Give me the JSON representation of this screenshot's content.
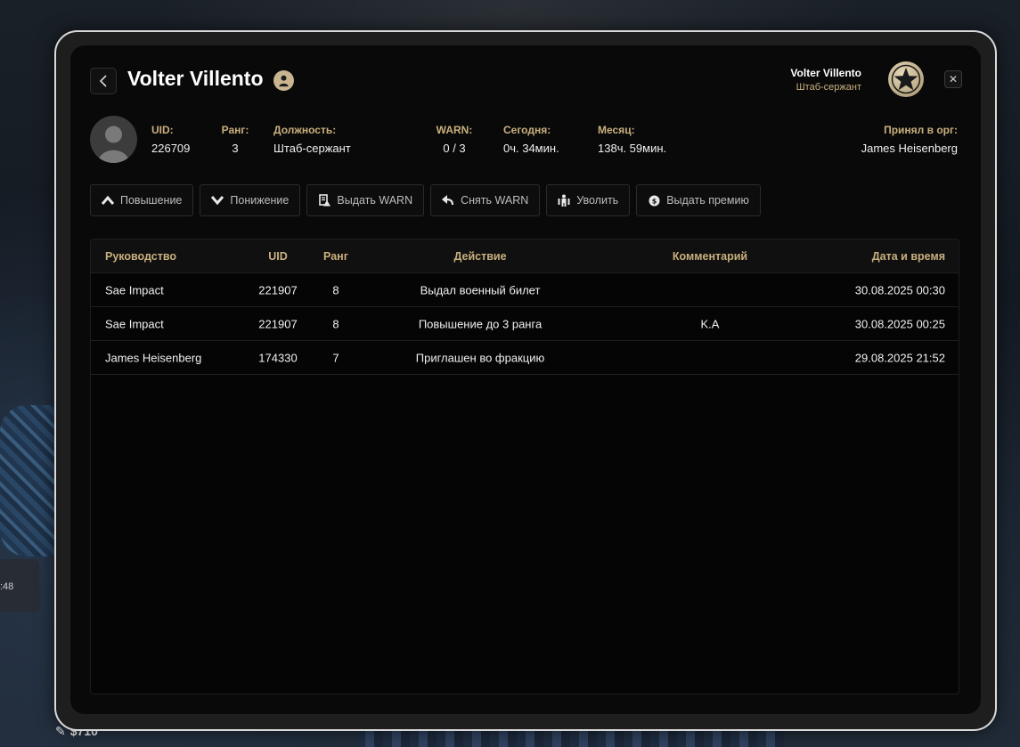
{
  "background": {
    "side_chip_text": ":48",
    "money": "$710"
  },
  "header": {
    "title": "Volter Villento",
    "user_name": "Volter Villento",
    "user_rank": "Штаб-сержант",
    "back_icon": "chevron-left-icon",
    "close_icon": "close-icon",
    "emblem_icon": "star-emblem-icon"
  },
  "info": {
    "uid_label": "UID:",
    "uid_value": "226709",
    "rank_label": "Ранг:",
    "rank_value": "3",
    "position_label": "Должность:",
    "position_value": "Штаб-сержант",
    "warn_label": "WARN:",
    "warn_value": "0 / 3",
    "today_label": "Сегодня:",
    "today_value": "0ч. 34мин.",
    "month_label": "Месяц:",
    "month_value": "138ч. 59мин.",
    "accepted_label": "Принял в орг:",
    "accepted_value": "James Heisenberg"
  },
  "actions": {
    "promote": "Повышение",
    "demote": "Понижение",
    "give_warn": "Выдать WARN",
    "remove_warn": "Снять WARN",
    "fire": "Уволить",
    "bonus": "Выдать премию"
  },
  "table": {
    "headers": {
      "leader": "Руководство",
      "uid": "UID",
      "rank": "Ранг",
      "action": "Действие",
      "comment": "Комментарий",
      "datetime": "Дата и время"
    },
    "rows": [
      {
        "leader": "Sae Impact",
        "uid": "221907",
        "rank": "8",
        "action": "Выдал военный билет",
        "comment": "",
        "datetime": "30.08.2025 00:30"
      },
      {
        "leader": "Sae Impact",
        "uid": "221907",
        "rank": "8",
        "action": "Повышение до 3 ранга",
        "comment": "K.A",
        "datetime": "30.08.2025 00:25"
      },
      {
        "leader": "James Heisenberg",
        "uid": "174330",
        "rank": "7",
        "action": "Приглашен во фракцию",
        "comment": "",
        "datetime": "29.08.2025 21:52"
      }
    ]
  },
  "colors": {
    "accent_gold": "#c9b07e",
    "screen_bg": "#090909",
    "frame_border": "#d9d9d9"
  }
}
